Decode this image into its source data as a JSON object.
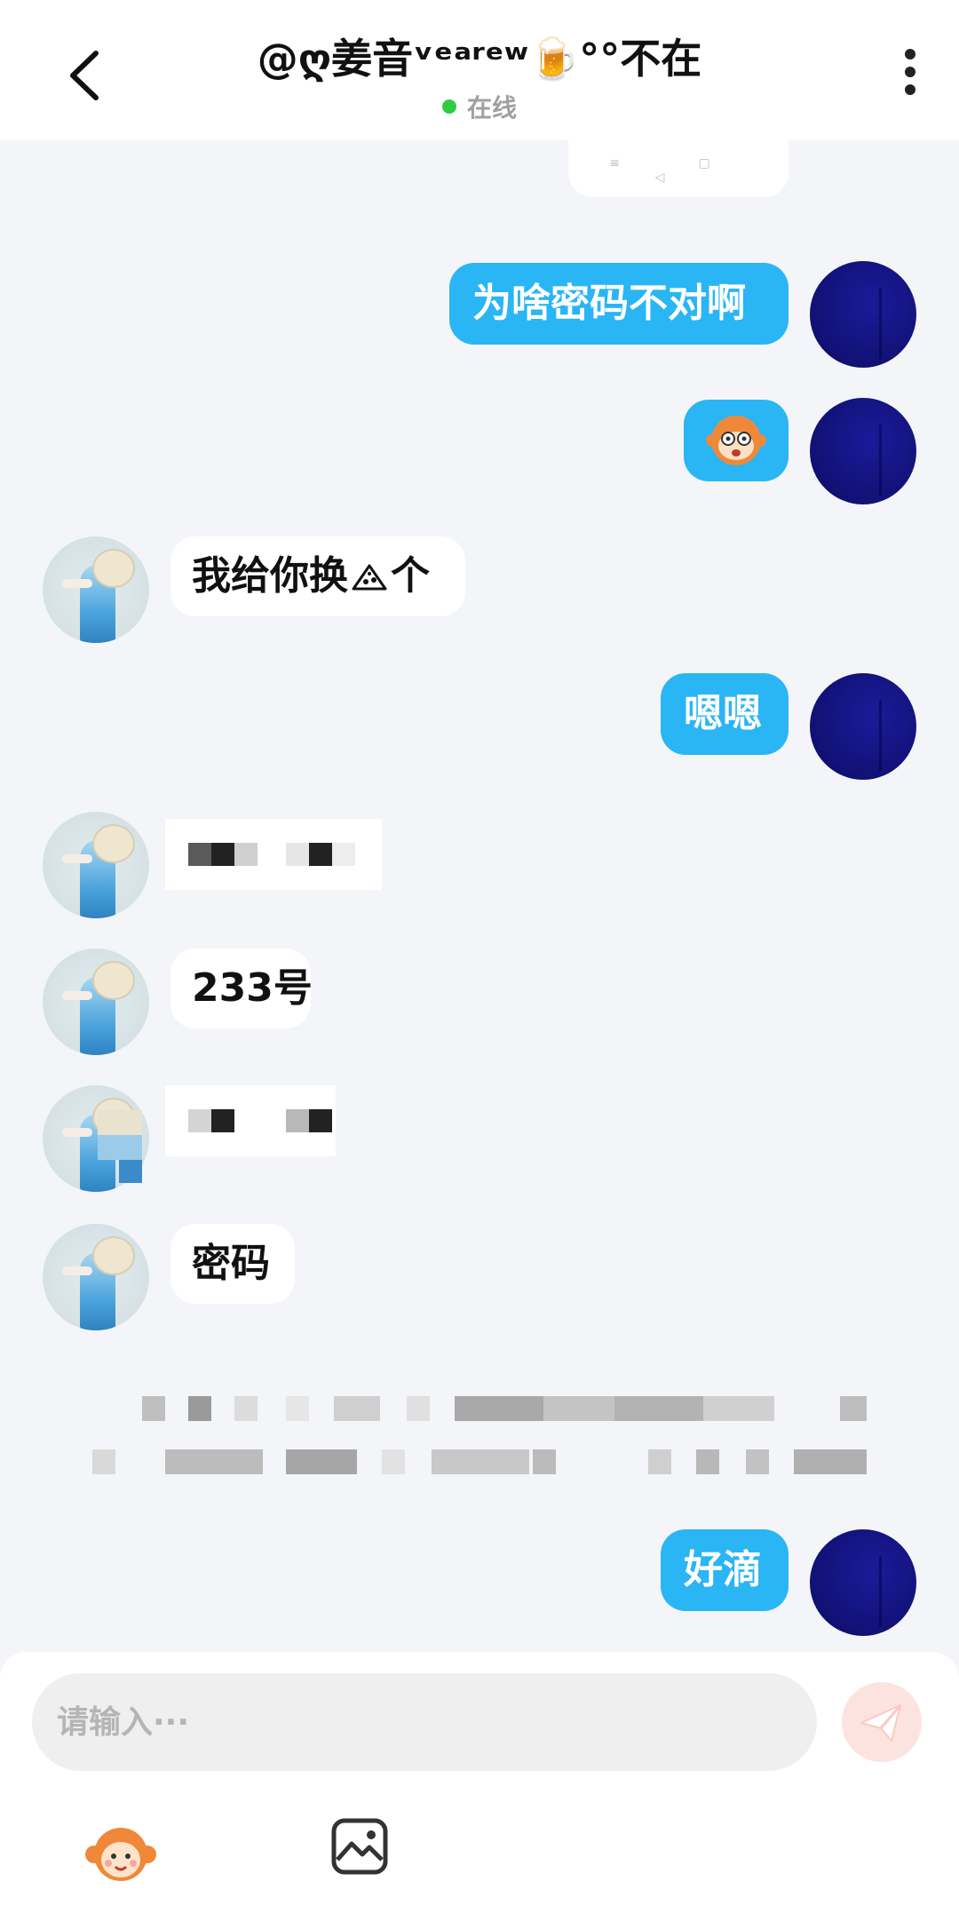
{
  "header": {
    "title": "@ღ姜音ᵛᵉᵃʳᵉʷ🍺°°不在",
    "status": "在线"
  },
  "messages": {
    "m1": "为啥密码不对啊",
    "m3": "我给你换",
    "m3_tail": "个",
    "m4": "嗯嗯",
    "m6": "233号",
    "m8": "密码",
    "m9": "好滴"
  },
  "input": {
    "placeholder": "请输入···"
  },
  "icons": {
    "back": "chevron-left-icon",
    "more": "more-vertical-icon",
    "send": "send-icon",
    "emoji": "emoji-icon",
    "image": "image-icon"
  },
  "colors": {
    "accent": "#2ab5f5",
    "online": "#2ecc40",
    "send_disabled": "#fde3e0"
  }
}
